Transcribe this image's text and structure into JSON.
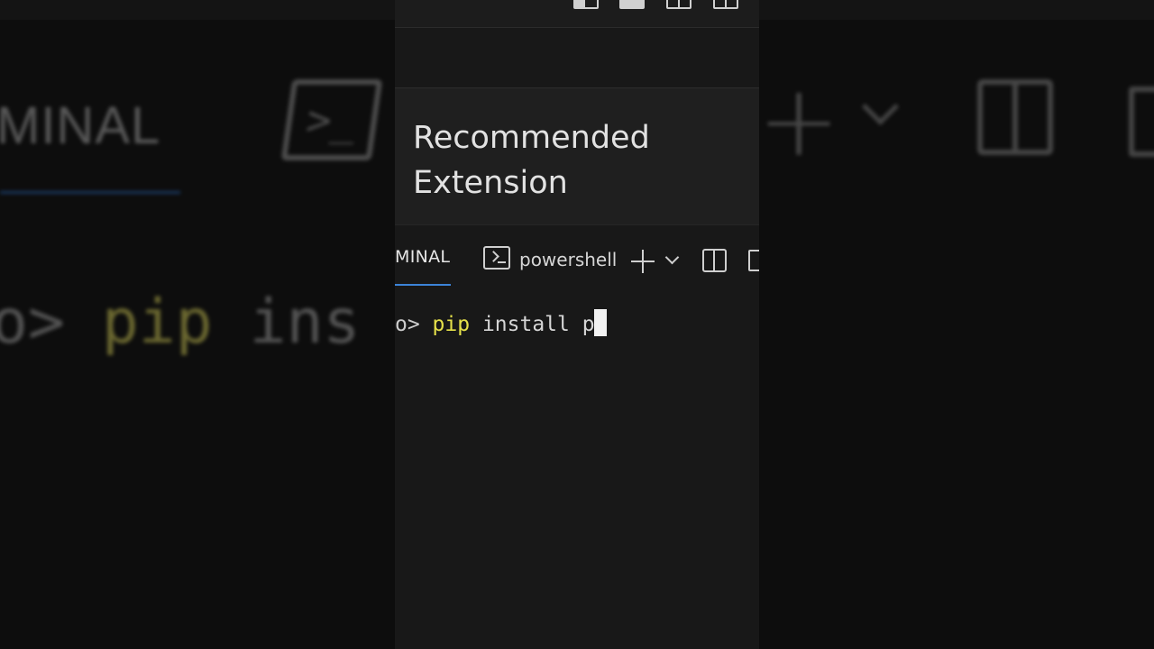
{
  "background": {
    "tab_label": "MINAL",
    "prompt_fragment": "o>",
    "command": "pip",
    "args_fragment": "ins"
  },
  "notification": {
    "title_line1": "Recommended",
    "title_line2": "Extension"
  },
  "terminal_panel": {
    "tab_label": "MINAL",
    "shell_icon": "terminal-powershell-icon",
    "shell_name": "powershell",
    "actions": [
      "new-terminal-icon",
      "chevron-down-icon",
      "split-terminal-icon",
      "trash-icon"
    ],
    "accent_color": "#3c83d8"
  },
  "terminal": {
    "prompt_fragment": "o> ",
    "command": "pip",
    "args": " install p"
  },
  "layout_controls": [
    "toggle-primary-sidebar-icon",
    "toggle-panel-icon",
    "toggle-secondary-sidebar-icon",
    "customize-layout-icon"
  ]
}
